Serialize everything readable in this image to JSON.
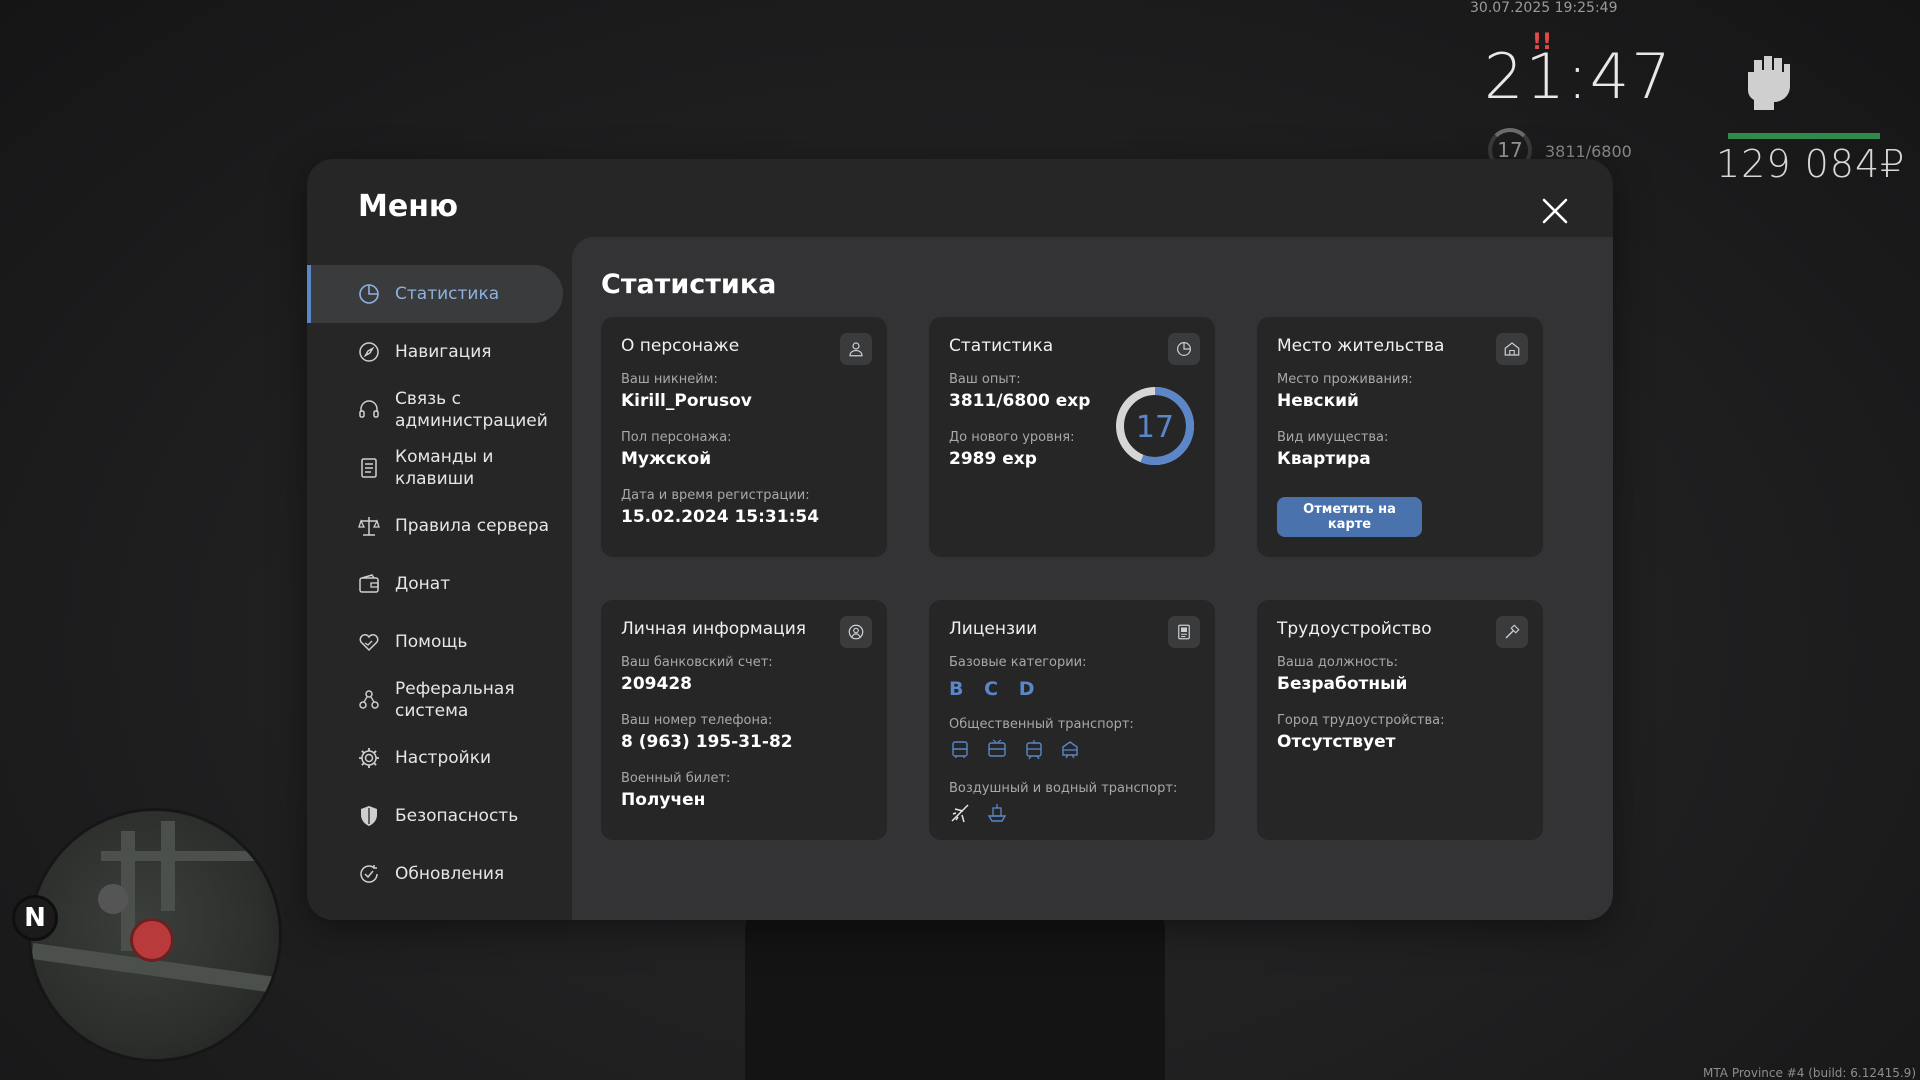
{
  "hud": {
    "datetime": "30.07.2025 19:25:49",
    "time": "21:47",
    "warning": "!!",
    "level": "17",
    "exp": "3811/6800",
    "money": "129 084₽",
    "build": "MTA Province #4 (build: 6.12415.9)",
    "map_north": "N"
  },
  "modal": {
    "title": "Меню",
    "close_icon": "close-icon"
  },
  "sidebar": {
    "items": [
      {
        "label": "Статистика",
        "icon": "pie-chart-icon",
        "active": true
      },
      {
        "label": "Навигация",
        "icon": "compass-icon"
      },
      {
        "label": "Связь с администрацией",
        "icon": "headset-icon"
      },
      {
        "label": "Команды и клавиши",
        "icon": "document-icon"
      },
      {
        "label": "Правила сервера",
        "icon": "scales-icon"
      },
      {
        "label": "Донат",
        "icon": "wallet-icon"
      },
      {
        "label": "Помощь",
        "icon": "heart-hand-icon"
      },
      {
        "label": "Реферальная система",
        "icon": "people-icon"
      },
      {
        "label": "Настройки",
        "icon": "gear-icon"
      },
      {
        "label": "Безопасность",
        "icon": "shield-icon"
      },
      {
        "label": "Обновления",
        "icon": "refresh-check-icon"
      }
    ]
  },
  "content": {
    "title": "Статистика",
    "character": {
      "title": "О персонаже",
      "icon": "user-icon",
      "nickname_label": "Ваш никнейм:",
      "nickname": "Kirill_Porusov",
      "gender_label": "Пол персонажа:",
      "gender": "Мужской",
      "reg_label": "Дата и время регистрации:",
      "reg": "15.02.2024 15:31:54"
    },
    "stats": {
      "title": "Статистика",
      "icon": "pie-chart-icon",
      "exp_label": "Ваш опыт:",
      "exp": "3811/6800 exp",
      "next_label": "До нового уровня:",
      "next": "2989 exp",
      "level": "17",
      "progress": 0.56
    },
    "residence": {
      "title": "Место жительства",
      "icon": "house-icon",
      "place_label": "Место проживания:",
      "place": "Невский",
      "type_label": "Вид имущества:",
      "type": "Квартира",
      "button": "Отметить на карте"
    },
    "personal": {
      "title": "Личная информация",
      "icon": "user-circle-icon",
      "bank_label": "Ваш банковский счет:",
      "bank": "209428",
      "phone_label": "Ваш номер телефона:",
      "phone": "8 (963) 195-31-82",
      "military_label": "Военный билет:",
      "military": "Получен"
    },
    "licenses": {
      "title": "Лицензии",
      "icon": "license-icon",
      "base_label": "Базовые категории:",
      "categories": [
        "B",
        "C",
        "D"
      ],
      "public_label": "Общественный транспорт:",
      "public_icons": [
        "bus-icon",
        "trolleybus-icon",
        "tram-icon",
        "metro-icon"
      ],
      "air_label": "Воздушный и водный транспорт:",
      "air_icons": [
        "plane-icon",
        "boat-icon"
      ],
      "accent": "#5b86c8"
    },
    "employment": {
      "title": "Трудоустройство",
      "icon": "hammer-icon",
      "position_label": "Ваша должность:",
      "position": "Безработный",
      "city_label": "Город трудоустройства:",
      "city": "Отсутствует"
    }
  },
  "colors": {
    "accent": "#5b86c8",
    "button": "#4a73ad",
    "modal_bg": "#262627",
    "content_bg": "#333335"
  }
}
